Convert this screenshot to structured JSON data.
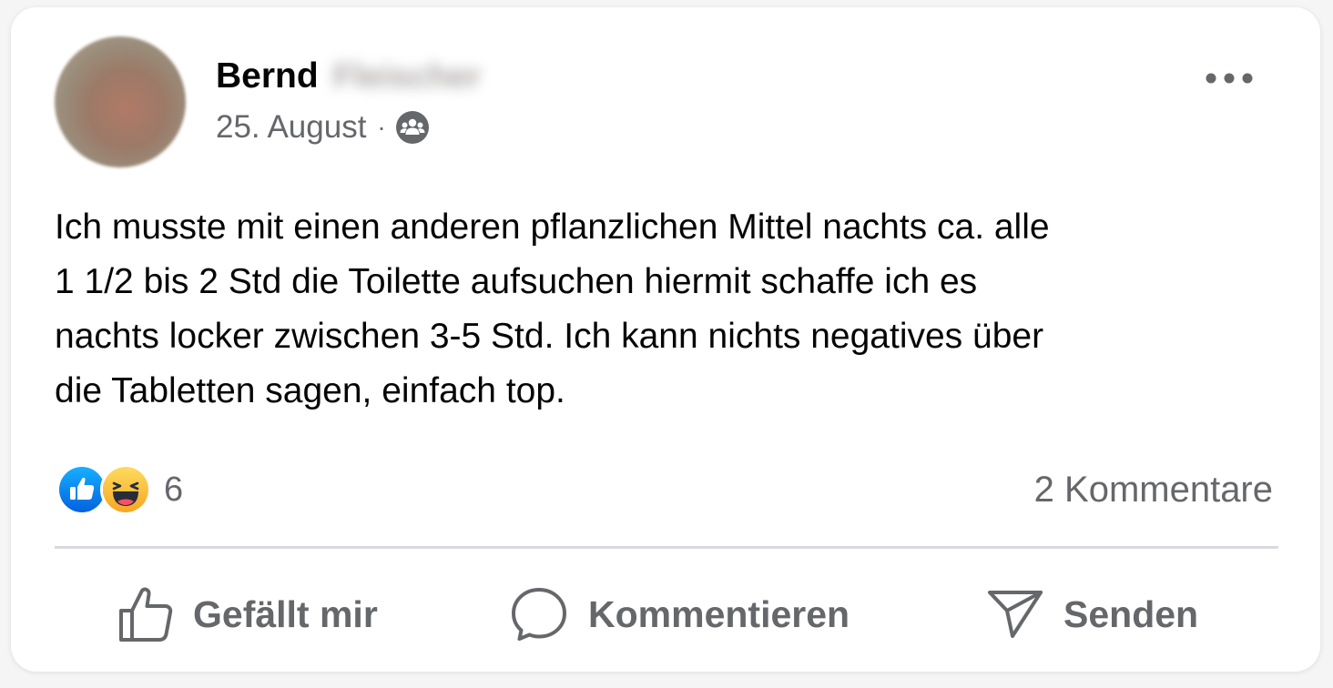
{
  "post": {
    "author": {
      "first_name": "Bernd",
      "last_name_blurred": "Fleischer"
    },
    "date": "25. August",
    "separator": "·",
    "audience_icon": "group-icon",
    "more_icon": "more-options-icon",
    "text": "Ich musste mit einen anderen pflanzlichen Mittel nachts ca. alle\n1 1/2 bis 2 Std die Toilette aufsuchen hiermit schaffe ich es\nnachts locker zwischen 3-5 Std. Ich kann nichts negatives über\ndie Tabletten sagen, einfach top.",
    "reactions": {
      "icons": [
        "like-reaction-icon",
        "haha-reaction-icon"
      ],
      "count": "6"
    },
    "comments_label": "2 Kommentare"
  },
  "actions": {
    "like": {
      "label": "Gefällt mir",
      "icon": "thumbs-up-icon"
    },
    "comment": {
      "label": "Kommentieren",
      "icon": "comment-bubble-icon"
    },
    "share": {
      "label": "Senden",
      "icon": "send-icon"
    }
  },
  "colors": {
    "text_primary": "#050505",
    "text_secondary": "#65676b",
    "like_blue": "#1877f2",
    "haha_yellow": "#f7b125",
    "divider": "#d8dadf"
  }
}
